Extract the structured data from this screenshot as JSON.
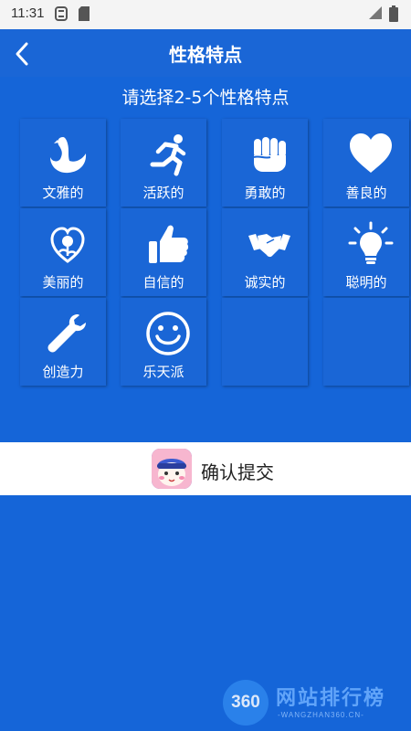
{
  "status_bar": {
    "time": "11:31"
  },
  "header": {
    "title": "性格特点"
  },
  "subtitle": "请选择2-5个性格特点",
  "traits": [
    {
      "label": "文雅的",
      "icon": "swan-icon"
    },
    {
      "label": "活跃的",
      "icon": "running-person-icon"
    },
    {
      "label": "勇敢的",
      "icon": "fist-icon"
    },
    {
      "label": "善良的",
      "icon": "heart-icon"
    },
    {
      "label": "美丽的",
      "icon": "heart-rose-icon"
    },
    {
      "label": "自信的",
      "icon": "thumbs-up-icon"
    },
    {
      "label": "诚实的",
      "icon": "handshake-icon"
    },
    {
      "label": "聪明的",
      "icon": "lightbulb-icon"
    },
    {
      "label": "创造力",
      "icon": "wrench-icon"
    },
    {
      "label": "乐天派",
      "icon": "smiley-icon"
    }
  ],
  "submit": {
    "label": "确认提交"
  },
  "watermark": {
    "badge": "360",
    "text": "网站排行榜",
    "sub": "-WANGZHAN360.CN-"
  }
}
